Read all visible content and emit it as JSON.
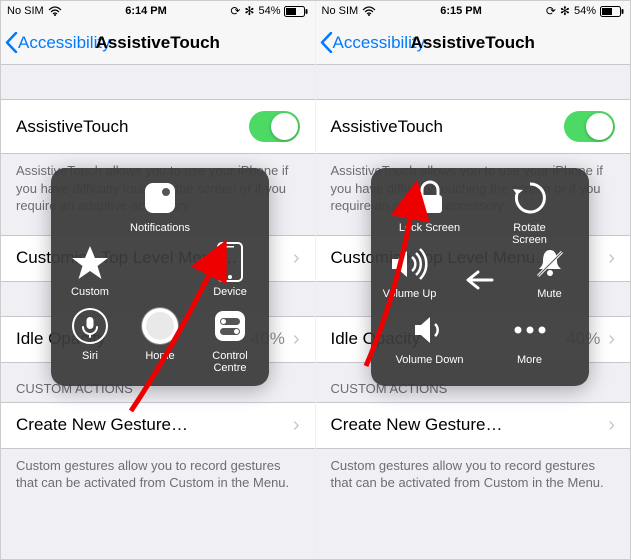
{
  "left": {
    "status": {
      "carrier": "No SIM",
      "time": "6:14 PM",
      "battery": "54%",
      "bt": "✻"
    },
    "nav": {
      "back": "Accessibility",
      "title": "AssistiveTouch"
    },
    "rows": {
      "main_label": "AssistiveTouch",
      "desc": "AssistiveTouch allows you to use your iPhone if you have difficulty touching the screen or if you require an adaptive accessory.",
      "custom_label": "Customise Top Level Menu…",
      "idle_label": "Idle Opacity",
      "idle_value": "40%",
      "section": "CUSTOM ACTIONS",
      "create_label": "Create New Gesture…",
      "create_desc": "Custom gestures allow you to record gestures that can be activated from Custom in the Menu."
    },
    "at": {
      "notifications": "Notifications",
      "custom": "Custom",
      "device": "Device",
      "siri": "Siri",
      "home": "Home",
      "control": "Control Centre"
    }
  },
  "right": {
    "status": {
      "carrier": "No SIM",
      "time": "6:15 PM",
      "battery": "54%",
      "bt": "✻"
    },
    "nav": {
      "back": "Accessibility",
      "title": "AssistiveTouch"
    },
    "rows": {
      "main_label": "AssistiveTouch",
      "desc": "AssistiveTouch allows you to use your iPhone if you have difficulty touching the screen or if you require an adaptive accessory.",
      "custom_label": "Customise Top Level Menu…",
      "idle_label": "Idle Opacity",
      "idle_value": "40%",
      "section": "CUSTOM ACTIONS",
      "create_label": "Create New Gesture…",
      "create_desc": "Custom gestures allow you to record gestures that can be activated from Custom in the Menu."
    },
    "at": {
      "lock": "Lock Screen",
      "rotate": "Rotate Screen",
      "volup": "Volume Up",
      "mute": "Mute",
      "voldown": "Volume Down",
      "more": "More"
    }
  }
}
